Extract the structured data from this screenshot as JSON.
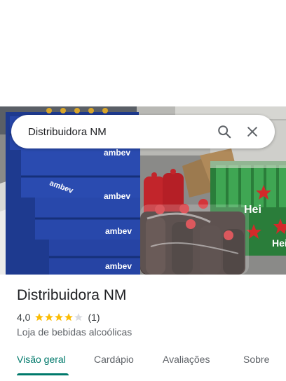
{
  "search": {
    "query": "Distribuidora NM",
    "search_icon": "search-icon",
    "clear_icon": "close-icon"
  },
  "hero": {
    "crate_text": "ambev",
    "bottle_brand": "Hei"
  },
  "place": {
    "name": "Distribuidora NM",
    "rating": "4,0",
    "stars_filled": 4,
    "stars_total": 5,
    "review_count": "(1)",
    "category": "Loja de bebidas alcoólicas"
  },
  "tabs": [
    {
      "label": "Visão geral",
      "active": true
    },
    {
      "label": "Cardápio",
      "active": false
    },
    {
      "label": "Avaliações",
      "active": false
    },
    {
      "label": "Sobre",
      "active": false
    }
  ],
  "colors": {
    "accent": "#00796b",
    "star": "#fbbc04",
    "star_empty": "#dadce0",
    "crate_blue": "#1f3f9a",
    "heineken_green": "#1f7a2e"
  }
}
